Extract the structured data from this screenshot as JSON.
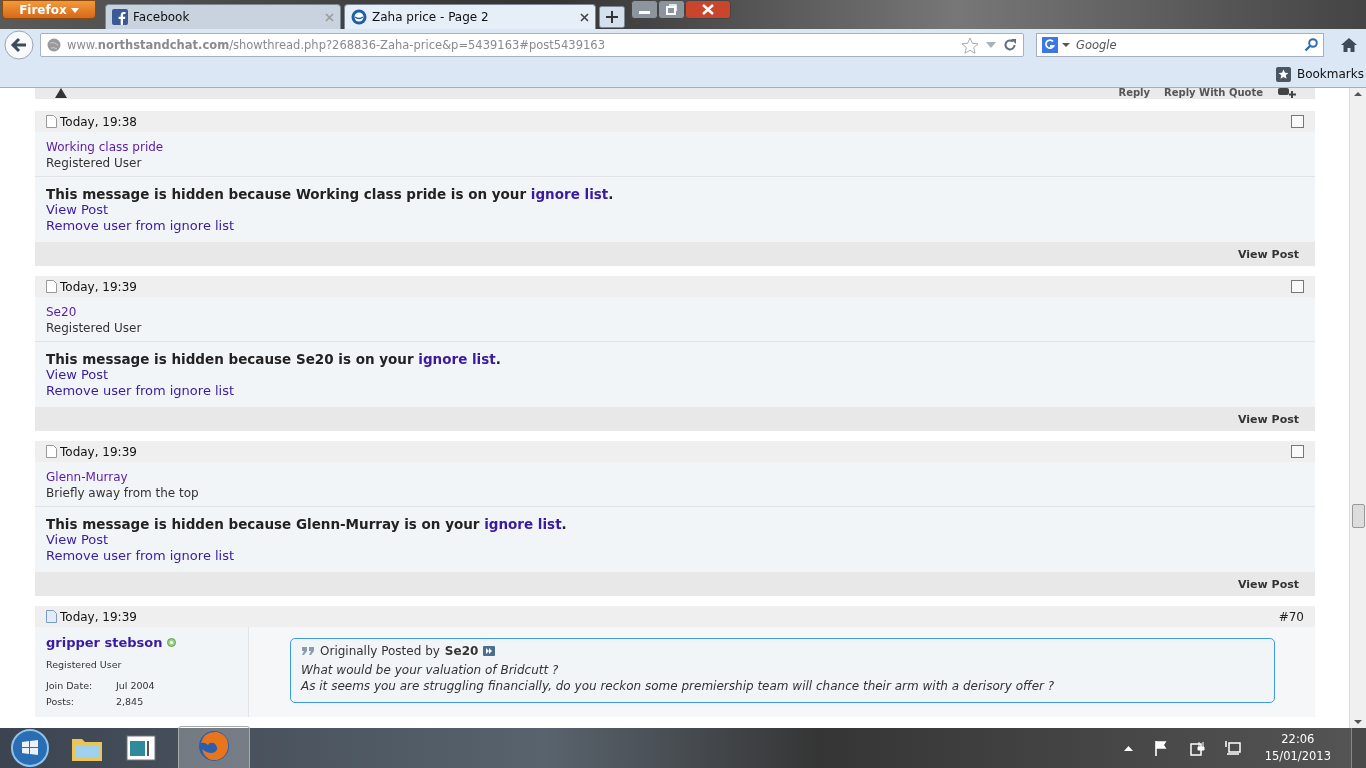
{
  "browser": {
    "menu_button": "Firefox",
    "tabs": [
      {
        "title": "Facebook",
        "selected": false
      },
      {
        "title": "Zaha price - Page 2",
        "selected": true
      }
    ],
    "address": "www.**northstandchat.com**/showthread.php?268836-Zaha-price&p=5439163#post5439163",
    "search": {
      "placeholder": "Google"
    },
    "bookmarks": "Bookmarks"
  },
  "post_toolbar": [
    "Reply",
    "Reply With Quote"
  ],
  "hidden_posts": [
    {
      "time": "Today, 19:38",
      "checked": false,
      "username": "Working class pride",
      "user_title": "Registered User",
      "message": "This message is hidden because Working class pride is on your",
      "link": "ignore list",
      "end": ".",
      "view_post": "View Post",
      "remove": "Remove user from ignore list",
      "footer_link": "View Post"
    },
    {
      "time": "Today, 19:39",
      "checked": false,
      "username": "Se20",
      "user_title": "Registered User",
      "message": "This message is hidden because Se20 is on your",
      "link": "ignore list",
      "end": ".",
      "view_post": "View Post",
      "remove": "Remove user from ignore list",
      "footer_link": "View Post"
    },
    {
      "time": "Today, 19:39",
      "checked": false,
      "username": "Glenn-Murray",
      "user_title": "Briefly away from the top",
      "message": "This message is hidden because Glenn-Murray is on your",
      "link": "ignore list",
      "end": ".",
      "view_post": "View Post",
      "remove": "Remove user from ignore list",
      "footer_link": "View Post"
    }
  ],
  "post": {
    "time": "Today, 19:39",
    "number": "#70",
    "username": "gripper stebson",
    "online": true,
    "user_title": "Registered User",
    "details": [
      {
        "label": "Join Date:",
        "value": "Jul 2004"
      },
      {
        "label": "Posts:",
        "value": "2,845"
      }
    ],
    "quote": {
      "prefix": "Originally Posted by",
      "author": "Se20",
      "lines": [
        "What would be your valuation of Bridcutt ?",
        "As it seems you are struggling financially, do you reckon some premiership team will chance their arm with a derisory offer ?"
      ]
    }
  },
  "taskbar": {
    "time": "22:06",
    "date": "15/01/2013"
  }
}
